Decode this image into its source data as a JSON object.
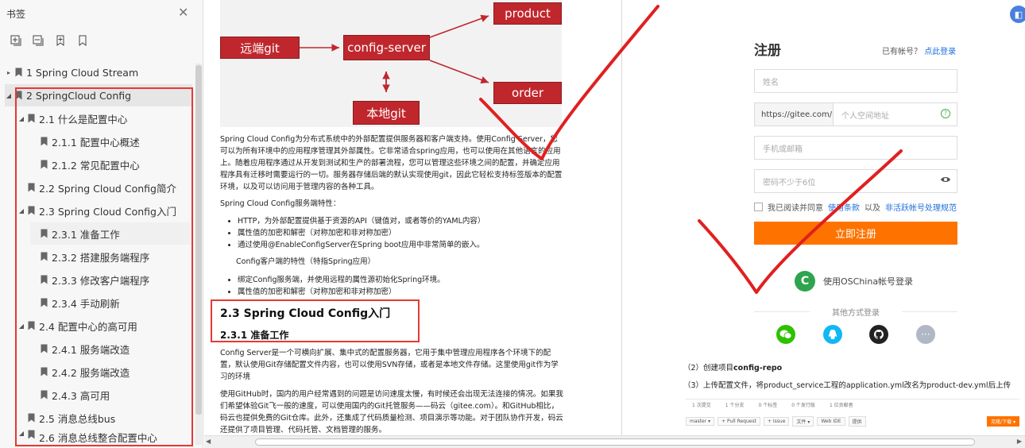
{
  "sidebar": {
    "title": "书签",
    "close_icon": "close-icon",
    "tools": [
      "expand-all-icon",
      "collapse-all-icon",
      "add-bookmark-icon",
      "bookmark-icon"
    ],
    "items": [
      {
        "label": "1 Spring Cloud Stream",
        "level": 0,
        "arrow": "▸"
      },
      {
        "label": "2 SpringCloud Config",
        "level": 0,
        "arrow": "◢"
      },
      {
        "label": "2.1 什么是配置中心",
        "level": 1,
        "arrow": "◢"
      },
      {
        "label": "2.1.1 配置中心概述",
        "level": 2,
        "arrow": ""
      },
      {
        "label": "2.1.2 常见配置中心",
        "level": 2,
        "arrow": ""
      },
      {
        "label": "2.2 Spring Cloud Config简介",
        "level": 1,
        "arrow": ""
      },
      {
        "label": "2.3 Spring Cloud Config入门",
        "level": 1,
        "arrow": "◢"
      },
      {
        "label": "2.3.1 准备工作",
        "level": 2,
        "arrow": ""
      },
      {
        "label": "2.3.2 搭建服务端程序",
        "level": 2,
        "arrow": ""
      },
      {
        "label": "2.3.3 修改客户端程序",
        "level": 2,
        "arrow": ""
      },
      {
        "label": "2.3.4 手动刷新",
        "level": 2,
        "arrow": ""
      },
      {
        "label": "2.4 配置中心的高可用",
        "level": 1,
        "arrow": "◢"
      },
      {
        "label": "2.4.1 服务端改造",
        "level": 2,
        "arrow": ""
      },
      {
        "label": "2.4.2 服务端改造",
        "level": 2,
        "arrow": ""
      },
      {
        "label": "2.4.3 高可用",
        "level": 2,
        "arrow": ""
      },
      {
        "label": "2.5 消息总线bus",
        "level": 1,
        "arrow": ""
      },
      {
        "label": "2.6 消息总线整合配置中心",
        "level": 1,
        "arrow": "◢"
      }
    ]
  },
  "doc": {
    "diagram": {
      "remote_git": "远端git",
      "config_server": "config-server",
      "local_git": "本地git",
      "product": "product",
      "order": "order"
    },
    "p1": "Spring Cloud Config为分布式系统中的外部配置提供服务器和客户端支持。使用Config Server，您可以为所有环境中的应用程序管理其外部属性。它非常适合spring应用，也可以使用在其他语言的应用上。随着应用程序通过从开发到测试和生产的部署流程，您可以管理这些环境之间的配置，并确定应用程序具有迁移时需要运行的一切。服务器存储后端的默认实现使用git，因此它轻松支持标签版本的配置环境，以及可以访问用于管理内容的各种工具。",
    "server_features_title": "Spring Cloud Config服务端特性：",
    "server_features": [
      "HTTP，为外部配置提供基于资源的API（键值对，或者等价的YAML内容）",
      "属性值的加密和解密（对称加密和非对称加密）",
      "通过使用@EnableConfigServer在Spring boot应用中非常简单的嵌入。"
    ],
    "client_features_title": "Config客户端的特性（特指Spring应用）",
    "client_features": [
      "绑定Config服务端，并使用远程的属性源初始化Spring环境。",
      "属性值的加密和解密（对称加密和非对称加密）"
    ],
    "h2": "2.3 Spring Cloud Config入门",
    "h3": "2.3.1 准备工作",
    "p2": "Config Server是一个可横向扩展、集中式的配置服务器，它用于集中管理应用程序各个环境下的配置，默认使用Git存储配置文件内容，也可以使用SVN存储，或者是本地文件存储。这里使用git作为学习的环境",
    "p3": "使用GitHub时，国内的用户经常遇到的问题是访问速度太慢，有时候还会出现无法连接的情况。如果我们希望体验Git飞一般的速度，可以使用国内的Git托管服务——码云（gitee.com）。和GitHub相比，码云也提供免费的Git仓库。此外，还集成了代码质量检测、项目演示等功能。对于团队协作开发，码云还提供了项目管理、代码托管、文档管理的服务。"
  },
  "register": {
    "title": "注册",
    "have_account": "已有帐号？",
    "login_link": "点此登录",
    "name_placeholder": "姓名",
    "url_prefix": "https://gitee.com/",
    "namespace_placeholder": "个人空间地址",
    "phone_placeholder": "手机或邮箱",
    "password_placeholder": "密码不少于6位",
    "agree_text": "我已阅读并同意",
    "agree_link1": "使用条款",
    "agree_and": "以及",
    "agree_link2": "非活跃帐号处理规范",
    "submit": "立即注册",
    "oschina": "使用OSChina帐号登录",
    "other_login": "其他方式登录",
    "step2_prefix": "（2）创建项目",
    "step2_bold": "config-repo",
    "step3": "（3）上传配置文件，将product_service工程的application.yml改名为product-dev.yml后上传",
    "repo_stats": [
      "1 次提交",
      "1 个分支",
      "0 个标签",
      "0 个发行版",
      "1 位贡献者"
    ],
    "repo_tools": [
      "master ▾",
      "+ Pull Request",
      "+ Issue",
      "文件 ▾",
      "Web IDE",
      "提供"
    ],
    "clone_button": "克隆/下载 ▾"
  },
  "colors": {
    "accent_red": "#e53935",
    "diagram_red": "#c0272d",
    "gitee_orange": "#fe7300",
    "link_blue": "#1e6fd9"
  }
}
